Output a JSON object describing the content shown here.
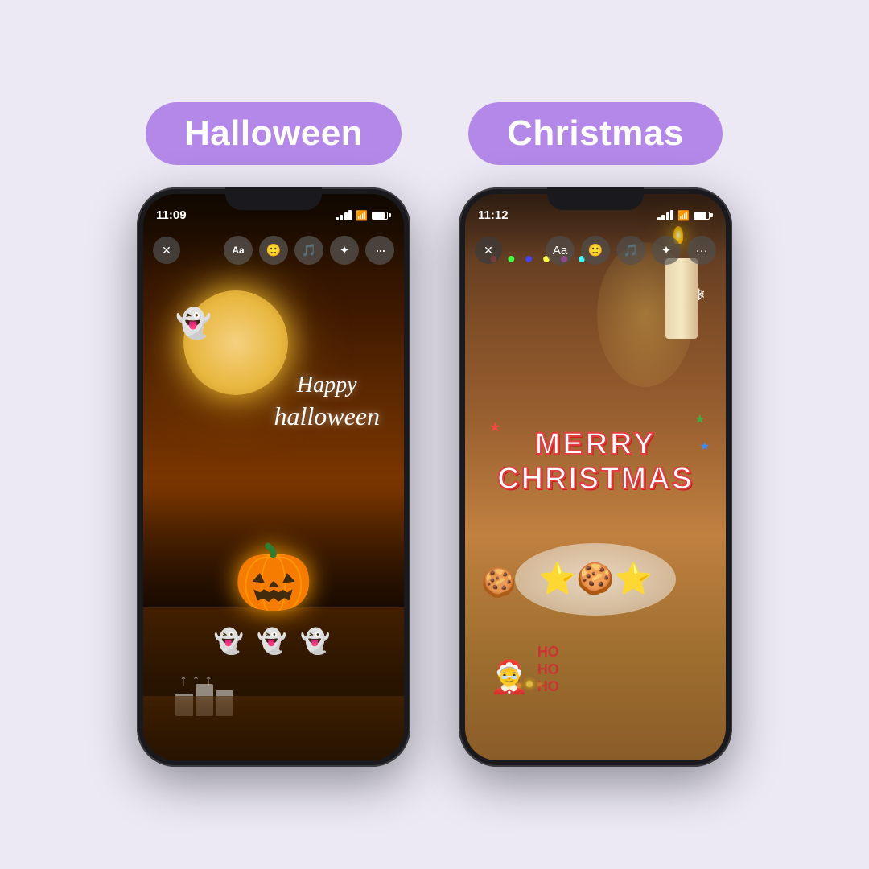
{
  "background": "#ece9f5",
  "sections": [
    {
      "id": "halloween",
      "label": "Halloween",
      "badge_color": "#b388e8",
      "time": "11:09",
      "holiday_text_line1": "Happy",
      "holiday_text_line2": "halloween"
    },
    {
      "id": "christmas",
      "label": "Christmas",
      "badge_color": "#b388e8",
      "time": "11:12",
      "merry_text": "MERRY",
      "christmas_text": "CHRISTMAS",
      "ho_text": "HO\nHO\nHO"
    }
  ],
  "toolbar": {
    "halloween_buttons": [
      "✕",
      "Aa",
      "☺",
      "♪",
      "✦",
      "···"
    ],
    "christmas_buttons": [
      "✕",
      "Aa",
      "☺",
      "♪",
      "✦",
      "···"
    ]
  }
}
